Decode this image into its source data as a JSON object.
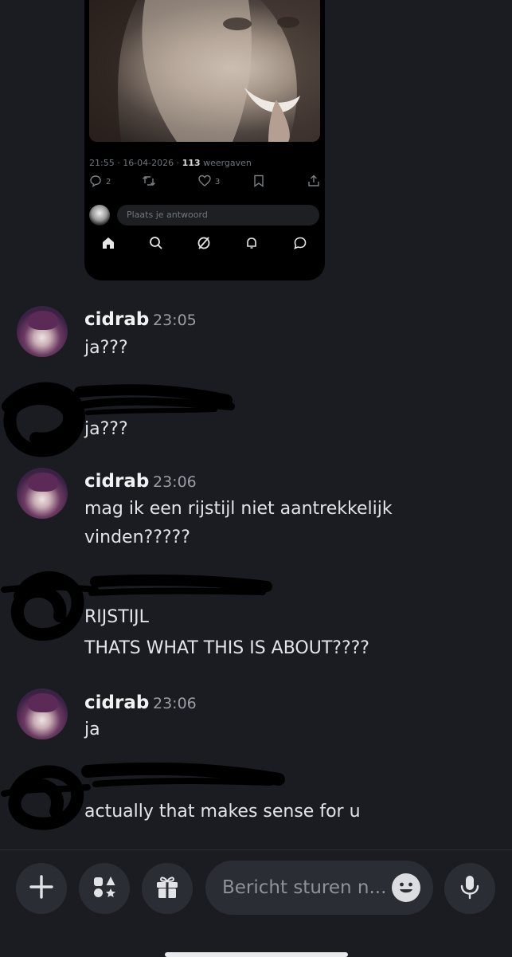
{
  "embed": {
    "meta_time": "21:55 · 16-04-2026 · ",
    "meta_views_count": "113",
    "meta_views_label": " weergaven",
    "reply_count": "2",
    "like_count": "3",
    "reply_placeholder": "Plaats je antwoord"
  },
  "messages": [
    {
      "username": "cidrab",
      "time": "23:05",
      "lines": [
        "ja???"
      ]
    },
    {
      "username": "",
      "time": "",
      "lines": [
        "ja???"
      ]
    },
    {
      "username": "cidrab",
      "time": "23:06",
      "lines": [
        "mag ik een rijstijl niet aantrekkelijk",
        "vinden?????"
      ]
    },
    {
      "username": "",
      "time": "",
      "lines": [
        "RIJSTIJL",
        "THATS WHAT THIS IS ABOUT????"
      ]
    },
    {
      "username": "cidrab",
      "time": "23:06",
      "lines": [
        "ja"
      ]
    },
    {
      "username": "",
      "time": "",
      "lines": [
        "actually that makes sense for u"
      ]
    }
  ],
  "composer": {
    "placeholder": "Bericht sturen n..."
  },
  "icons": {
    "add": "plus-icon",
    "apps": "apps-icon",
    "gift": "gift-icon",
    "emoji": "emoji-icon",
    "mic": "microphone-icon"
  },
  "colors": {
    "background": "#1b1c21",
    "surface": "#2b2d34",
    "text": "#e3e4e8",
    "muted": "#9a9da6"
  }
}
